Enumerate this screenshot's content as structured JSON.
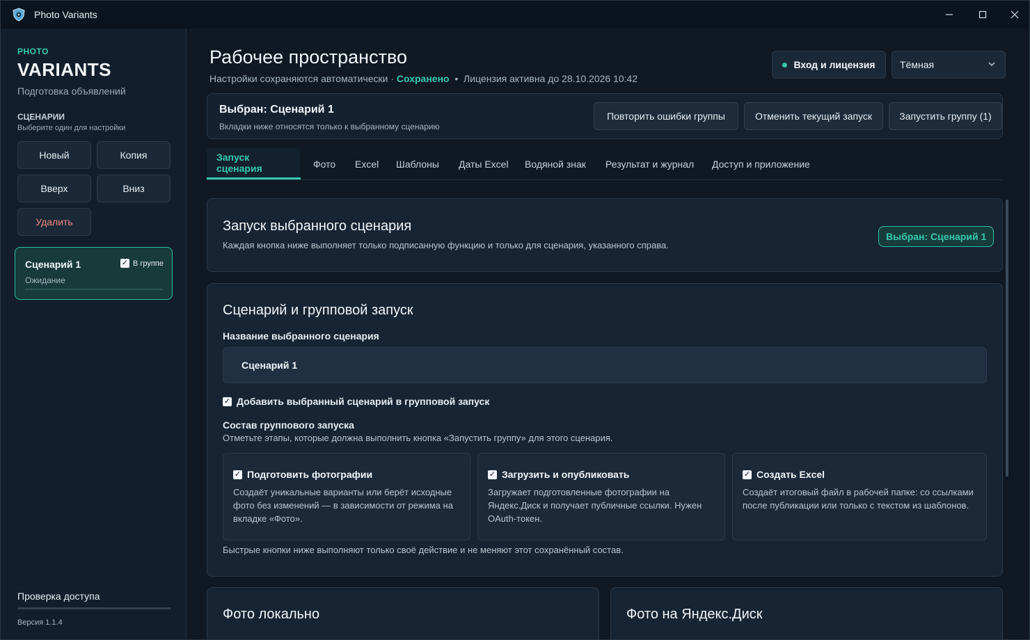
{
  "window": {
    "title": "Photo Variants"
  },
  "sidebar": {
    "brand_top": "PHOTO",
    "brand_main": "VARIANTS",
    "brand_sub": "Подготовка объявлений",
    "section_title": "СЦЕНАРИИ",
    "section_sub": "Выберите один для настройки",
    "buttons": {
      "new": "Новый",
      "copy": "Копия",
      "up": "Вверх",
      "down": "Вниз",
      "delete": "Удалить"
    },
    "scenario": {
      "name": "Сценарий 1",
      "in_group_label": "В группе",
      "in_group": true,
      "status": "Ожидание"
    },
    "access_check": "Проверка доступа",
    "version": "Версия 1.1.4"
  },
  "header": {
    "title": "Рабочее пространство",
    "autosave_text": "Настройки сохраняются автоматически · ",
    "saved": "Сохранено",
    "license_text": "  •  Лицензия активна до 28.10.2026 10:42",
    "login_button": "Вход и лицензия",
    "theme_value": "Тёмная"
  },
  "selection": {
    "title": "Выбран: Сценарий 1",
    "subtitle": "Вкладки ниже относятся только к выбранному сценарию",
    "retry_button": "Повторить ошибки группы",
    "cancel_button": "Отменить текущий запуск",
    "run_button": "Запустить группу (1)"
  },
  "tabs": [
    "Запуск сценария",
    "Фото",
    "Excel",
    "Шаблоны",
    "Даты Excel",
    "Водяной знак",
    "Результат и журнал",
    "Доступ и приложение"
  ],
  "launch_card": {
    "title": "Запуск выбранного сценария",
    "desc": "Каждая кнопка ниже выполняет только подписанную функцию и только для сценария, указанного справа.",
    "badge": "Выбран: Сценарий 1"
  },
  "group_card": {
    "title": "Сценарий и групповой запуск",
    "name_label": "Название выбранного сценария",
    "name_value": "Сценарий 1",
    "add_to_group": "Добавить выбранный сценарий в групповой запуск",
    "composition_title": "Состав группового запуска",
    "composition_desc": "Отметьте этапы, которые должна выполнить кнопка «Запустить группу» для этого сценария.",
    "steps": [
      {
        "title": "Подготовить фотографии",
        "desc": "Создаёт уникальные варианты или берёт исходные фото без изменений — в зависимости от режима на вкладке «Фото»."
      },
      {
        "title": "Загрузить и опубликовать",
        "desc": "Загружает подготовленные фотографии на Яндекс.Диск и получает публичные ссылки. Нужен OAuth-токен."
      },
      {
        "title": "Создать Excel",
        "desc": "Создаёт итоговый файл в рабочей папке: со ссылками после публикации или только с текстом из шаблонов."
      }
    ],
    "note": "Быстрые кнопки ниже выполняют только своё действие и не меняют этот сохранённый состав."
  },
  "photo_cards": {
    "local": "Фото локально",
    "disk": "Фото на Яндекс.Диск"
  },
  "colors": {
    "accent": "#36c9b0",
    "danger": "#f08a80",
    "bg": "#0f1823"
  }
}
